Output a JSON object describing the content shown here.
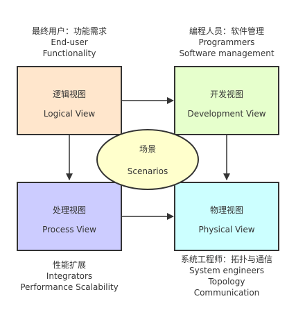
{
  "captions": {
    "top_left": [
      "最终用户：功能需求",
      "End-user",
      "Functionality"
    ],
    "top_right": [
      "编程人员：软件管理",
      "Programmers",
      "Software management"
    ],
    "bottom_left": [
      "性能扩展",
      "Integrators",
      "Performance Scalability"
    ],
    "bottom_right": [
      "系统工程师：拓扑与通信",
      "System engineers",
      "Topology",
      "Communication"
    ]
  },
  "boxes": {
    "logical": {
      "cn": "逻辑视图",
      "en": "Logical View",
      "fill": "#ffe6cc"
    },
    "development": {
      "cn": "开发视图",
      "en": "Development View",
      "fill": "#e6ffcc"
    },
    "process": {
      "cn": "处理视图",
      "en": "Process View",
      "fill": "#ccccff"
    },
    "physical": {
      "cn": "物理视图",
      "en": "Physical View",
      "fill": "#ccffff"
    }
  },
  "center": {
    "cn": "场景",
    "en": "Scenarios",
    "fill": "#ffffcc"
  },
  "colors": {
    "stroke": "#333333",
    "text": "#333333"
  }
}
